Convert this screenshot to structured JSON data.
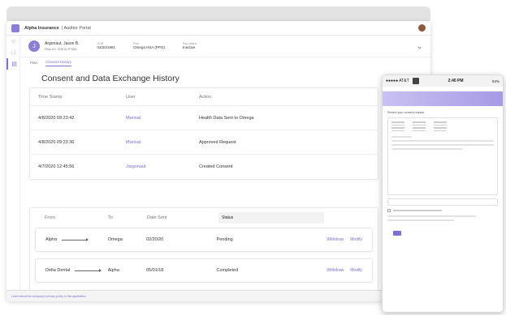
{
  "app": {
    "brand": "Alpha Insurance",
    "portal": "| Auditor Portal"
  },
  "patient": {
    "initial": "J",
    "name": "Argonaut, Jason B.",
    "id": "Plan ID: VDE217F939",
    "fields": [
      {
        "label": "DOB",
        "value": "03/20/1981"
      },
      {
        "label": "Plan",
        "value": "Omega HSA (PPO)"
      },
      {
        "label": "Plan status",
        "value": "Inactive"
      }
    ]
  },
  "tabs": [
    {
      "label": "Plan"
    },
    {
      "label": "Consent History"
    }
  ],
  "page_title": "Consent and Data Exchange History",
  "history_table": {
    "headers": [
      "Time Stamp",
      "User",
      "Action"
    ],
    "rows": [
      {
        "ts": "4/8/2020 09:23:42",
        "user": "Marinal.",
        "action": "Health Data Sent to Omega"
      },
      {
        "ts": "4/8/2020 09:23:36",
        "user": "Marinal.",
        "action": "Approved Request"
      },
      {
        "ts": "4/7/2020 12:45:56",
        "user": "Jargonaut",
        "action": "Created Consent"
      }
    ]
  },
  "exchange_table": {
    "headers": [
      "From",
      "To",
      "Date Sent",
      "Status"
    ],
    "rows": [
      {
        "from": "Alpha",
        "to": "Omega",
        "date": "02/20/20",
        "status": "Pending",
        "actions": [
          "Withdraw",
          "Modify"
        ]
      },
      {
        "from": "Delta Dental",
        "to": "Alpha",
        "date": "05/01/18",
        "status": "Completed",
        "actions": [
          "Withdraw",
          "Modify"
        ]
      }
    ]
  },
  "footer_link": "Learn about the company's privacy policy in this application",
  "mobile": {
    "carrier": "●●●●● AT&T",
    "time": "2:40 PM",
    "battery": "84%",
    "title": "Review your consent request"
  },
  "colors": {
    "accent": "#7b6ed6",
    "brand_square": "#8a7fd6"
  },
  "icons": {
    "sidebar": [
      "user-icon",
      "document-icon",
      "history-icon"
    ],
    "expand": "chevron-down-icon",
    "battery": "battery-icon"
  }
}
